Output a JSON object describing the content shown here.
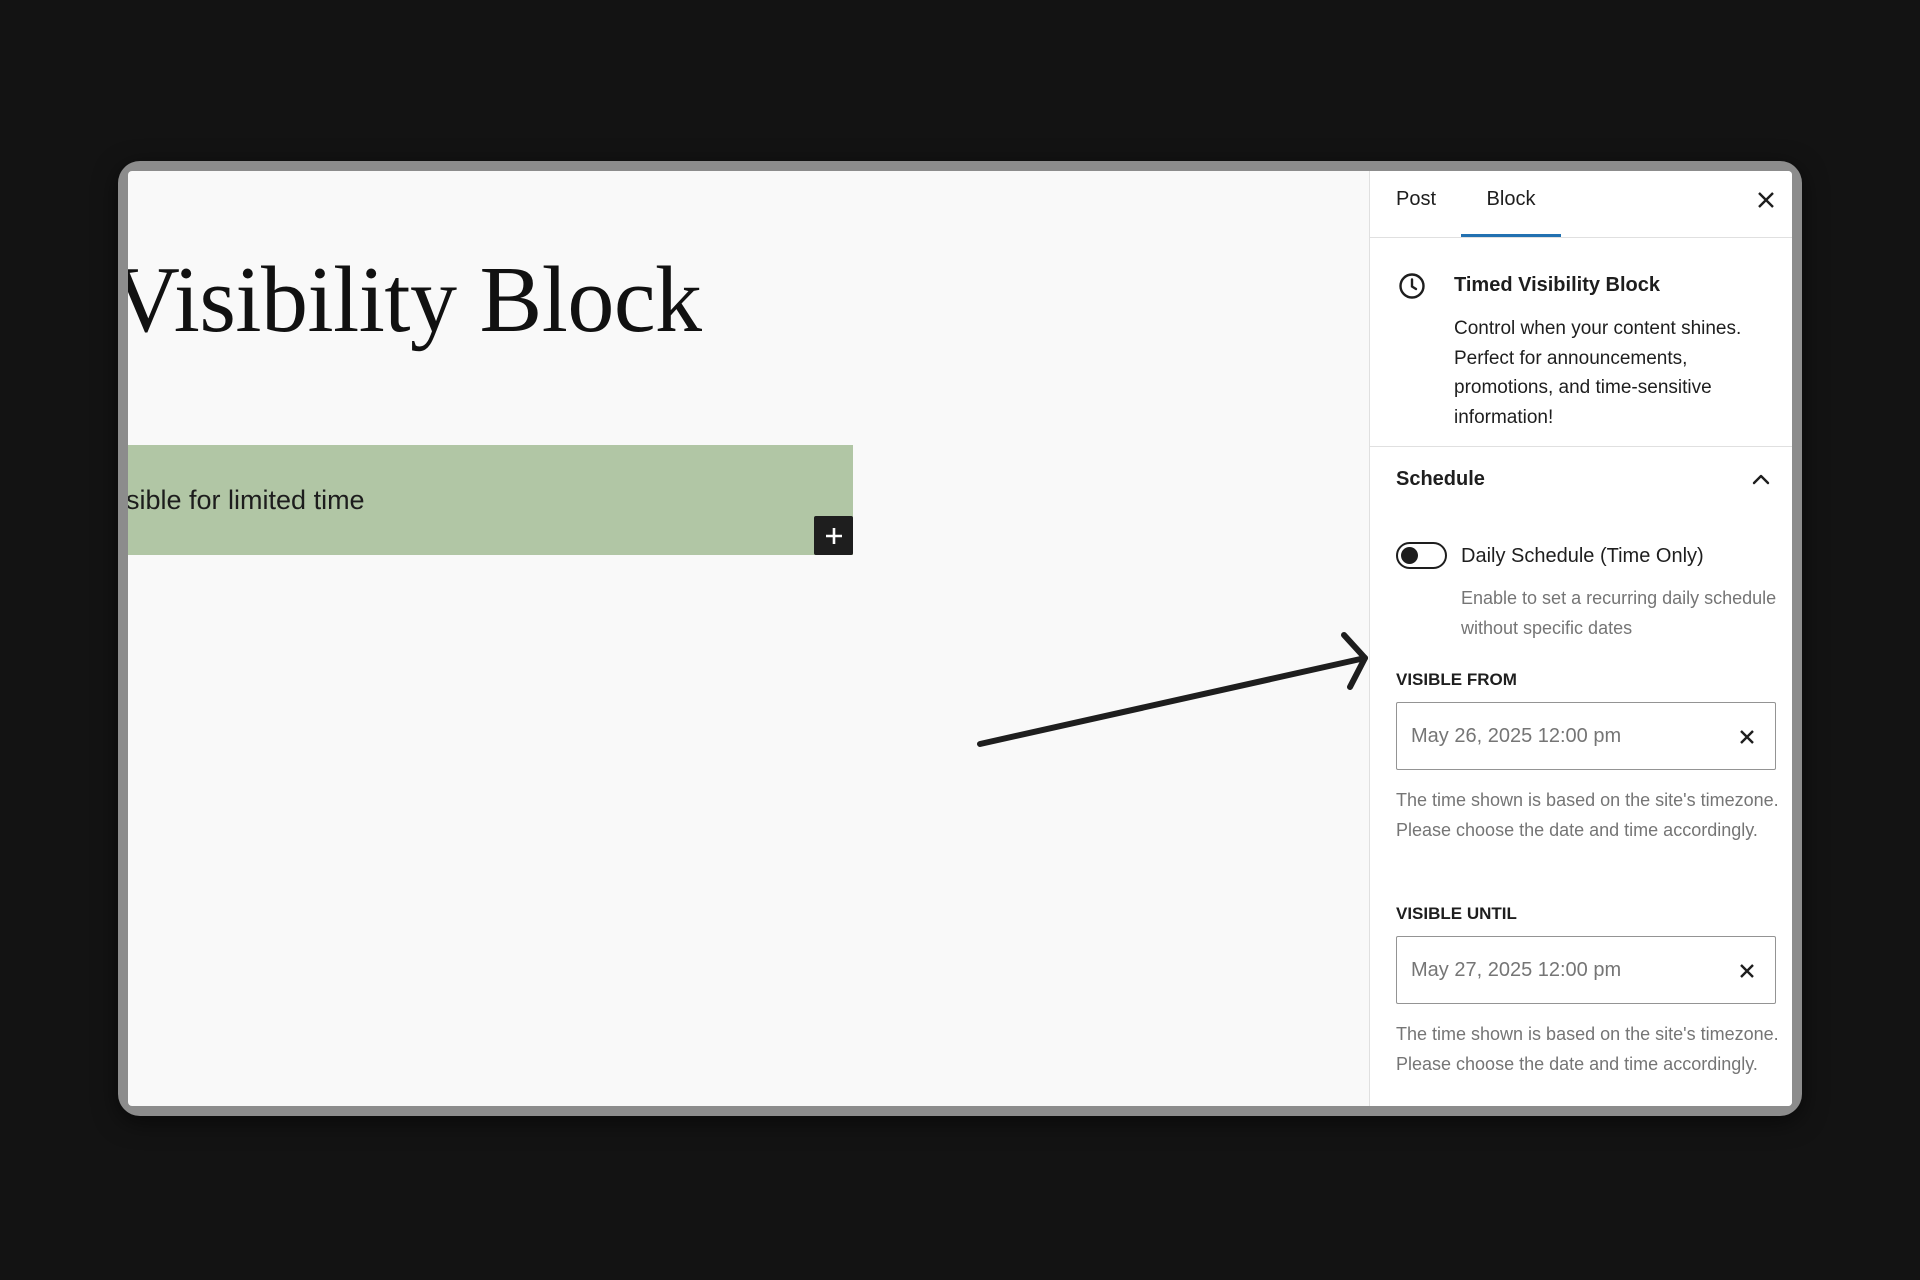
{
  "canvas": {
    "heading": "Visibility Block",
    "group_text": "sible for limited time",
    "colors": {
      "group_background": "#b1c6a5",
      "inserter": "#1e1e1e"
    }
  },
  "sidebar": {
    "tabs": [
      {
        "label": "Post",
        "active": false
      },
      {
        "label": "Block",
        "active": true
      }
    ],
    "accent_color": "#2271b1",
    "block_card": {
      "icon": "clock-icon",
      "title": "Timed Visibility Block",
      "description": "Control when your content shines. Perfect for announcements, promotions, and time-sensitive information!"
    },
    "schedule_panel": {
      "title": "Schedule",
      "expanded": true,
      "daily_toggle": {
        "label": "Daily Schedule (Time Only)",
        "checked": false,
        "help": "Enable to set a recurring daily schedule without specific dates"
      },
      "visible_from": {
        "label": "VISIBLE FROM",
        "value": "May 26, 2025 12:00 pm",
        "help": "The time shown is based on the site's timezone. Please choose the date and time accordingly."
      },
      "visible_until": {
        "label": "VISIBLE UNTIL",
        "value": "May 27, 2025 12:00 pm",
        "help": "The time shown is based on the site's timezone. Please choose the date and time accordingly."
      }
    }
  }
}
